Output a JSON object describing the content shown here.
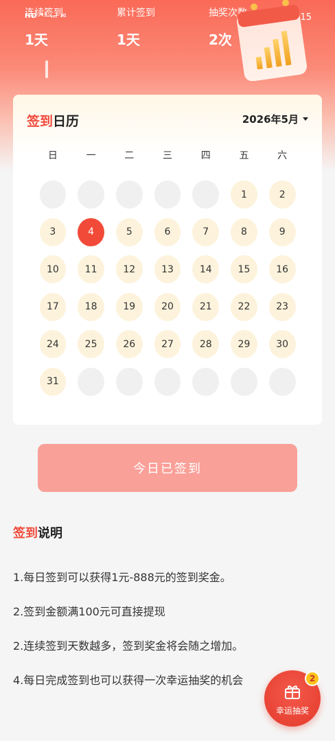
{
  "status_bar": {
    "left": "HD ⁴⁶ ᵢₗₗ ✉",
    "time": "15:15"
  },
  "stats": [
    {
      "label": "连续签到",
      "value": "1天"
    },
    {
      "label": "累计签到",
      "value": "1天"
    },
    {
      "label": "抽奖次数",
      "value": "2次"
    }
  ],
  "calendar": {
    "title_red": "签到",
    "title_black": "日历",
    "month": "2026年5月",
    "weekdays": [
      "日",
      "一",
      "二",
      "三",
      "四",
      "五",
      "六"
    ],
    "weeks": [
      [
        "",
        "",
        "",
        "",
        "",
        "1",
        "2"
      ],
      [
        "3",
        "4",
        "5",
        "6",
        "7",
        "8",
        "9"
      ],
      [
        "10",
        "11",
        "12",
        "13",
        "14",
        "15",
        "16"
      ],
      [
        "17",
        "18",
        "19",
        "20",
        "21",
        "22",
        "23"
      ],
      [
        "24",
        "25",
        "26",
        "27",
        "28",
        "29",
        "30"
      ],
      [
        "31",
        "",
        "",
        "",
        "",
        "",
        ""
      ]
    ],
    "today": "4"
  },
  "signin_button": "今日已签到",
  "rules": {
    "title_red": "签到",
    "title_black": "说明",
    "items": [
      "1.每日签到可以获得1元-888元的签到奖金。",
      "2.签到金额满100元可直接提现",
      "2.连续签到天数越多，签到奖金将会随之增加。",
      "4.每日完成签到也可以获得一次幸运抽奖的机会"
    ]
  },
  "lucky_draw": {
    "label": "幸运抽奖",
    "badge": "2"
  },
  "colors": {
    "accent": "#f04a3c",
    "today": "#f24a38",
    "day_bg": "#fdf3dc",
    "button": "#f9a099",
    "badge": "#ffc21a"
  }
}
